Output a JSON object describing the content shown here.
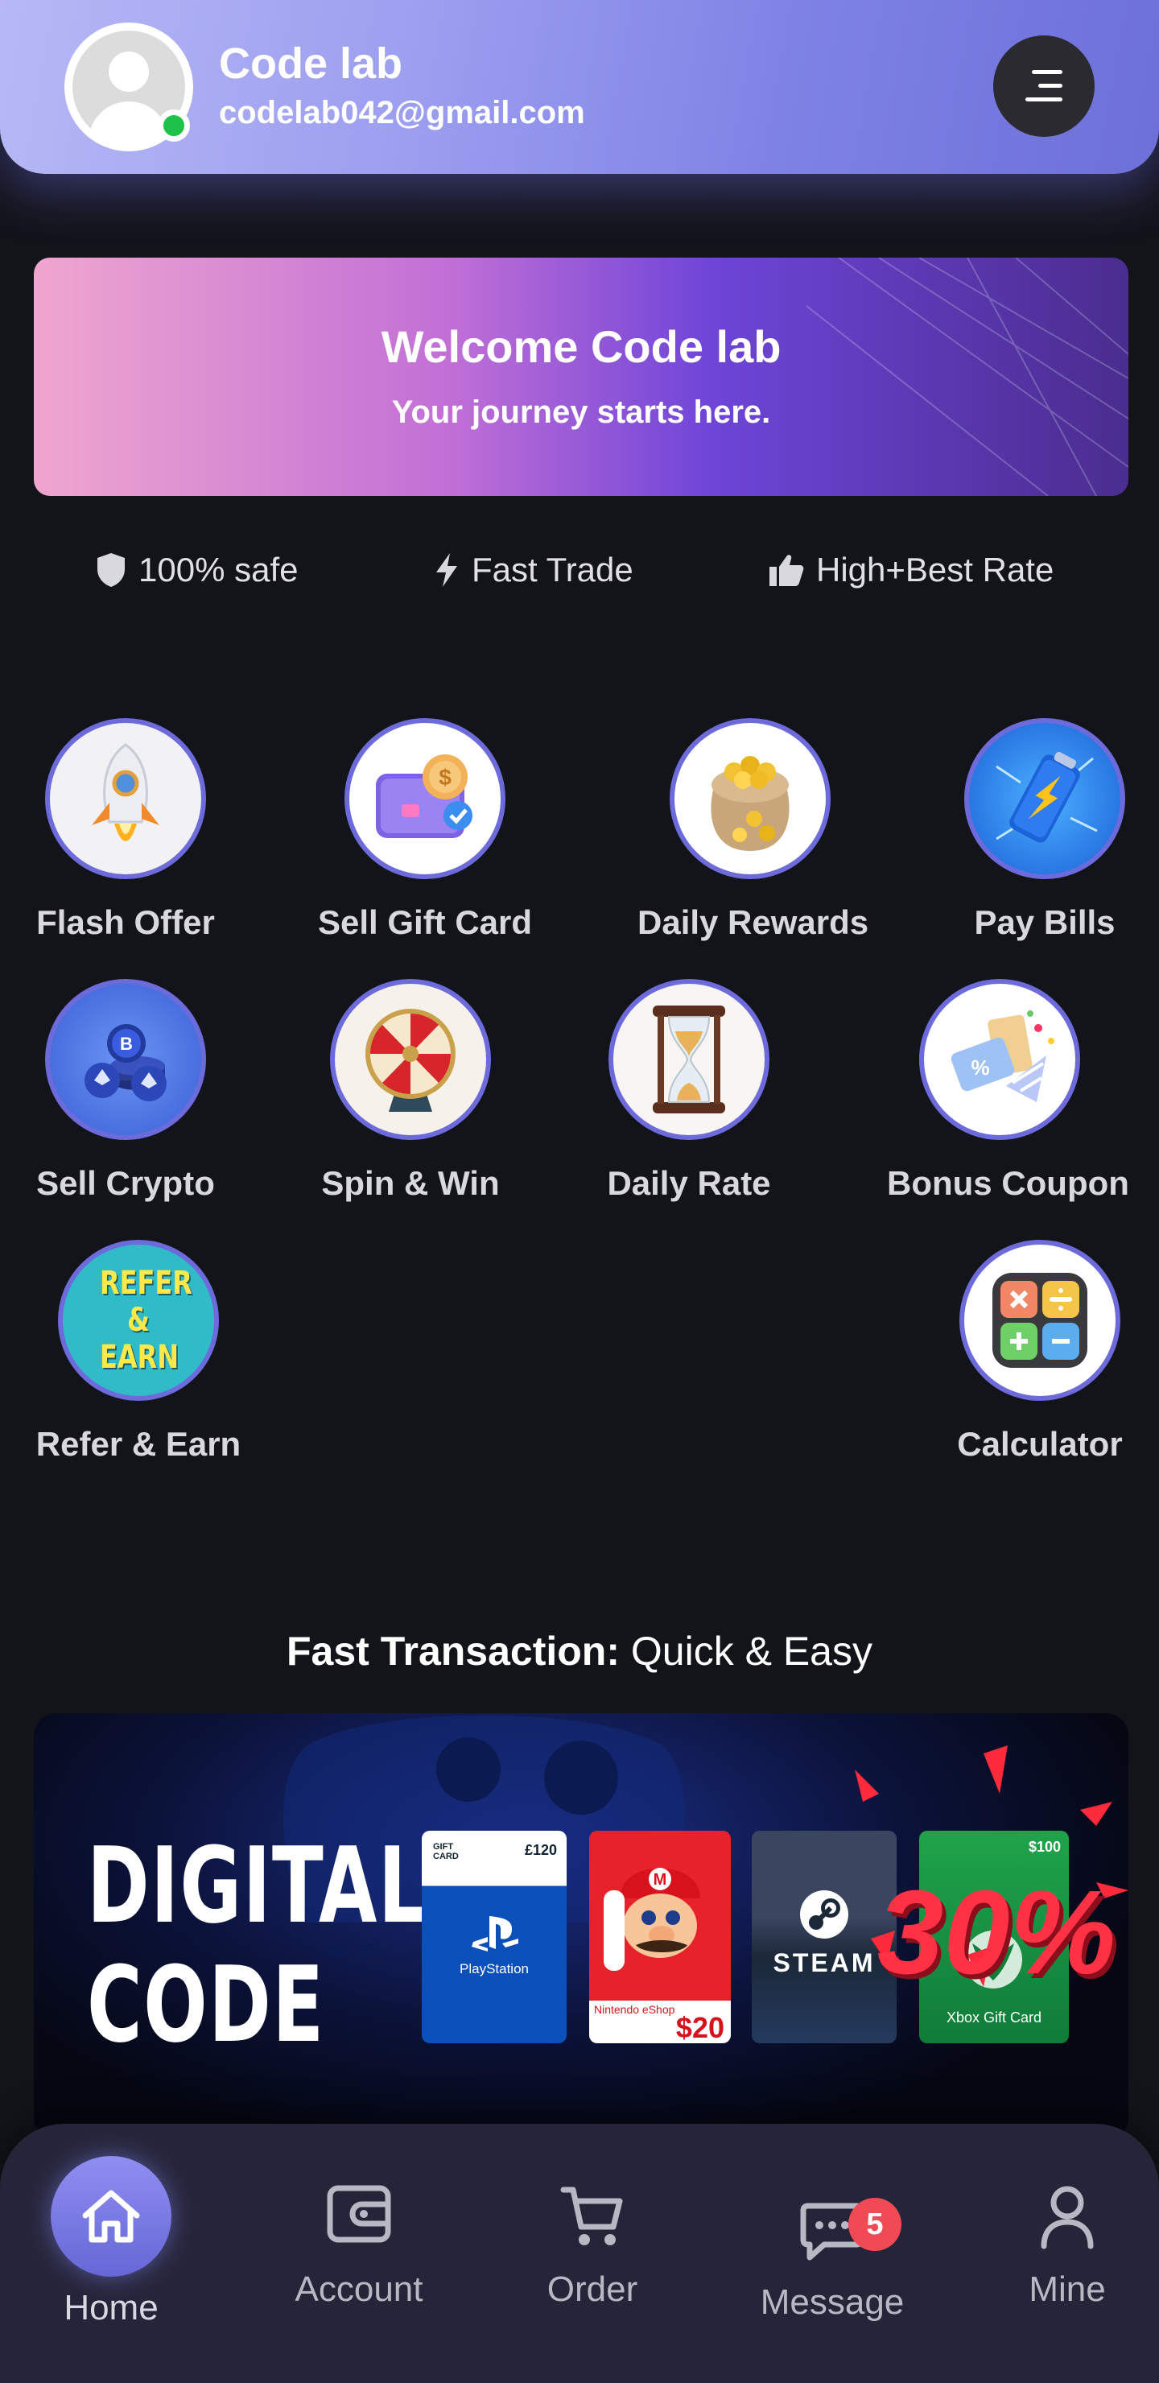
{
  "header": {
    "user_name": "Code lab",
    "user_email": "codelab042@gmail.com",
    "online_color": "#1ec24a"
  },
  "banner": {
    "title": "Welcome Code lab",
    "subtitle": "Your journey starts here."
  },
  "features": [
    {
      "label": "100% safe",
      "icon": "shield-icon"
    },
    {
      "label": "Fast Trade",
      "icon": "lightning-icon"
    },
    {
      "label": "High+Best Rate",
      "icon": "thumbs-up-icon"
    }
  ],
  "services": [
    {
      "label": "Flash Offer",
      "icon": "rocket-icon"
    },
    {
      "label": "Sell Gift Card",
      "icon": "wallet-coin-icon"
    },
    {
      "label": "Daily Rewards",
      "icon": "gold-sack-icon"
    },
    {
      "label": "Pay Bills",
      "icon": "battery-icon"
    },
    {
      "label": "Sell Crypto",
      "icon": "crypto-coins-icon"
    },
    {
      "label": "Spin & Win",
      "icon": "prize-wheel-icon"
    },
    {
      "label": "Daily Rate",
      "icon": "hourglass-icon"
    },
    {
      "label": "Bonus Coupon",
      "icon": "coupon-icon"
    },
    {
      "label": "Refer & Earn",
      "icon": "refer-earn-icon"
    },
    {
      "label": "Calculator",
      "icon": "calculator-icon"
    }
  ],
  "refer_badge_text": "REFER & EARN",
  "fast_transaction": {
    "bold": "Fast Transaction:",
    "rest": " Quick & Easy"
  },
  "promo": {
    "line1": "DIGITAL",
    "line2": "CODE",
    "discount": "30%",
    "cards": [
      {
        "name": "PlayStation",
        "tag": "GIFT CARD",
        "value": "£120"
      },
      {
        "name": "Nintendo eShop",
        "value": "$20"
      },
      {
        "name": "STEAM"
      },
      {
        "name": "Xbox Gift Card",
        "value": "$100"
      }
    ]
  },
  "nav": {
    "home": "Home",
    "account": "Account",
    "order": "Order",
    "message": "Message",
    "message_badge": "5",
    "mine": "Mine"
  }
}
